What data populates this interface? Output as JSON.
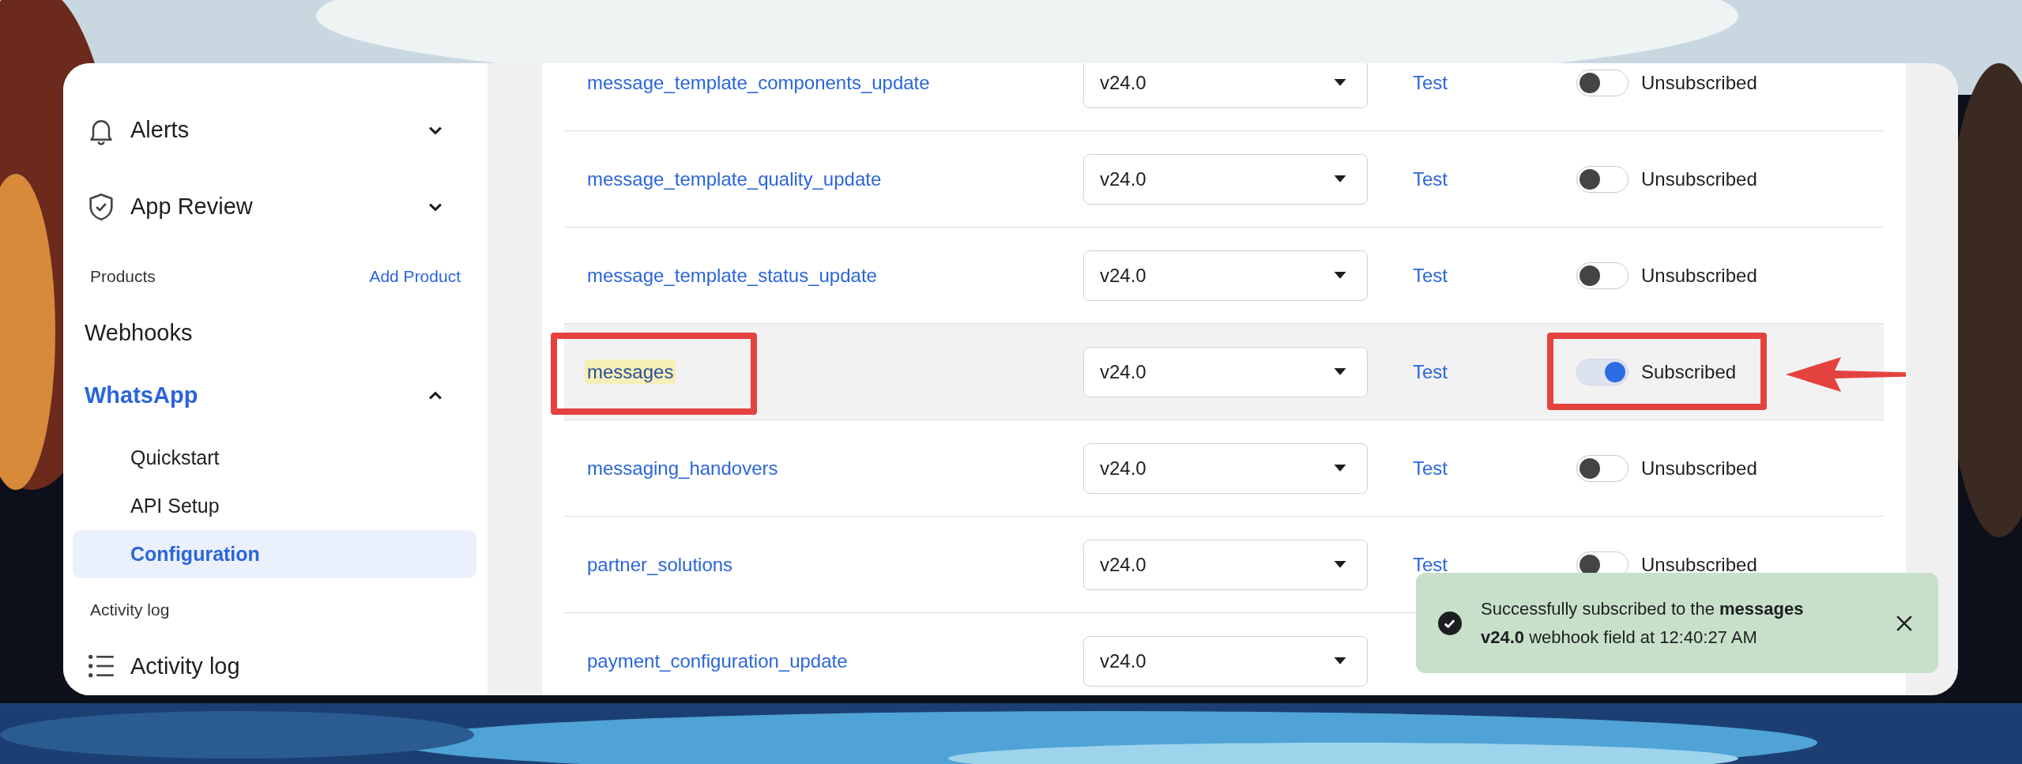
{
  "sidebar": {
    "items": [
      {
        "kind": "group",
        "label": "Alerts",
        "expanded": false,
        "active": false
      },
      {
        "kind": "group",
        "label": "App Review",
        "expanded": false,
        "active": false
      },
      {
        "kind": "header",
        "label": "Products",
        "action": "Add Product"
      },
      {
        "kind": "link",
        "label": "Webhooks"
      },
      {
        "kind": "group",
        "label": "WhatsApp",
        "expanded": true,
        "active": true,
        "children": [
          {
            "label": "Quickstart",
            "selected": false
          },
          {
            "label": "API Setup",
            "selected": false
          },
          {
            "label": "Configuration",
            "selected": true
          }
        ]
      },
      {
        "kind": "header",
        "label": "Activity log"
      },
      {
        "kind": "link",
        "label": "Activity log"
      }
    ]
  },
  "webhook_fields": {
    "rows": [
      {
        "name": "message_template_components_update",
        "version": "v24.0",
        "test": "Test",
        "subscribed": false,
        "status": "Unsubscribed",
        "hovered": false,
        "found": false,
        "annotated": false
      },
      {
        "name": "message_template_quality_update",
        "version": "v24.0",
        "test": "Test",
        "subscribed": false,
        "status": "Unsubscribed",
        "hovered": false,
        "found": false,
        "annotated": false
      },
      {
        "name": "message_template_status_update",
        "version": "v24.0",
        "test": "Test",
        "subscribed": false,
        "status": "Unsubscribed",
        "hovered": false,
        "found": false,
        "annotated": false
      },
      {
        "name": "messages",
        "version": "v24.0",
        "test": "Test",
        "subscribed": true,
        "status": "Subscribed",
        "hovered": true,
        "found": true,
        "annotated": true
      },
      {
        "name": "messaging_handovers",
        "version": "v24.0",
        "test": "Test",
        "subscribed": false,
        "status": "Unsubscribed",
        "hovered": false,
        "found": false,
        "annotated": false
      },
      {
        "name": "partner_solutions",
        "version": "v24.0",
        "test": "Test",
        "subscribed": false,
        "status": "Unsubscribed",
        "hovered": false,
        "found": false,
        "annotated": false
      },
      {
        "name": "payment_configuration_update",
        "version": "v24.0",
        "hovered": false,
        "found": false,
        "annotated": false
      }
    ]
  },
  "toast": {
    "message": "Successfully subscribed to the **messages v24.0** webhook field at 12:40:27 AM"
  }
}
